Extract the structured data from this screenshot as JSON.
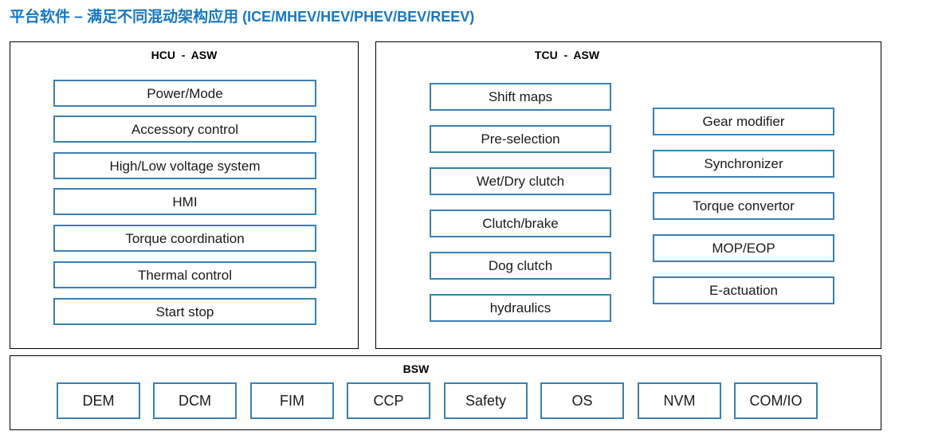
{
  "title": {
    "cjk": "平台软件 – 满足不同混动架构应用",
    "latin": " (ICE/MHEV/HEV/PHEV/BEV/REEV)",
    "color": "#1878bf"
  },
  "colors": {
    "title_blue": "#1878bf",
    "box_border_blue": "#3a80b3",
    "panel_border": "#000000",
    "background": "#ffffff",
    "text": "#1a1a1a"
  },
  "panels": {
    "hcu": {
      "header": "HCU  -  ASW",
      "modules": [
        "Power/Mode",
        "Accessory control",
        "High/Low voltage system",
        "HMI",
        "Torque coordination",
        "Thermal control",
        "Start stop"
      ]
    },
    "tcu": {
      "header": "TCU  -  ASW",
      "left_modules": [
        "Shift maps",
        "Pre-selection",
        "Wet/Dry clutch",
        "Clutch/brake",
        "Dog clutch",
        "hydraulics"
      ],
      "right_modules": [
        "Gear modifier",
        "Synchronizer",
        "Torque convertor",
        "MOP/EOP",
        "E-actuation"
      ]
    },
    "bsw": {
      "header": "BSW",
      "modules": [
        "DEM",
        "DCM",
        "FIM",
        "CCP",
        "Safety",
        "OS",
        "NVM",
        "COM/IO"
      ]
    }
  }
}
